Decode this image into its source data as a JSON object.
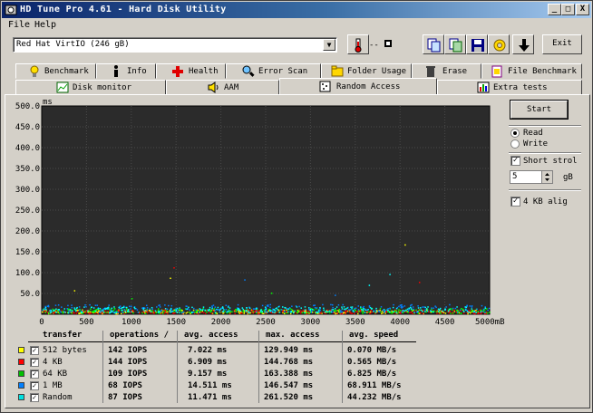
{
  "window": {
    "title": "HD Tune Pro 4.61 - Hard Disk Utility",
    "min_label": "_",
    "max_label": "□",
    "close_label": "X"
  },
  "menu": {
    "file": "File",
    "help": "Help"
  },
  "toolbar": {
    "drive": "Red Hat VirtIO (246 gB)",
    "temperature": "--",
    "exit_label": "Exit",
    "icons": [
      "thermometer-icon",
      "copy-icon",
      "copy-text-icon",
      "save-icon",
      "options-icon",
      "download-icon"
    ]
  },
  "tabs_row1": [
    {
      "label": "Benchmark",
      "icon": "benchmark-icon"
    },
    {
      "label": "Info",
      "icon": "info-icon"
    },
    {
      "label": "Health",
      "icon": "health-icon"
    },
    {
      "label": "Error Scan",
      "icon": "error-scan-icon"
    },
    {
      "label": "Folder Usage",
      "icon": "folder-icon"
    },
    {
      "label": "Erase",
      "icon": "erase-icon"
    },
    {
      "label": "File Benchmark",
      "icon": "file-benchmark-icon"
    }
  ],
  "tabs_row2": [
    {
      "label": "Disk monitor",
      "icon": "disk-monitor-icon"
    },
    {
      "label": "AAM",
      "icon": "speaker-icon"
    },
    {
      "label": "Random Access",
      "icon": "random-access-icon",
      "active": true
    },
    {
      "label": "Extra tests",
      "icon": "extra-tests-icon"
    }
  ],
  "controls": {
    "start_label": "Start",
    "read_label": "Read",
    "write_label": "Write",
    "mode_selected": "Read",
    "short_stroke_label": "Short strol",
    "short_stroke_checked": true,
    "stroke_value": "5",
    "stroke_unit": "gB",
    "align_label": "4 KB alig",
    "align_checked": true
  },
  "chart_data": {
    "type": "scatter",
    "ylabel": "ms",
    "xlabel": "mB",
    "xlim": [
      0,
      5000
    ],
    "ylim": [
      0,
      500
    ],
    "y_ticks": [
      "500.0",
      "450.0",
      "400.0",
      "350.0",
      "300.0",
      "250.0",
      "200.0",
      "150.0",
      "100.0",
      "50.0"
    ],
    "x_ticks": [
      "0",
      "500",
      "1000",
      "1500",
      "2000",
      "2500",
      "3000",
      "3500",
      "4000",
      "4500",
      "5000mB"
    ],
    "series": [
      {
        "name": "512 bytes",
        "color": "#ffff00",
        "typical_ms": 7.0
      },
      {
        "name": "4 KB",
        "color": "#ff0000",
        "typical_ms": 6.9
      },
      {
        "name": "64 KB",
        "color": "#00ff00",
        "typical_ms": 9.2
      },
      {
        "name": "1 MB",
        "color": "#0080ff",
        "typical_ms": 14.5
      },
      {
        "name": "Random",
        "color": "#00ffff",
        "typical_ms": 11.5
      }
    ],
    "outliers": [
      {
        "x": 1430,
        "y": 88
      },
      {
        "x": 1470,
        "y": 113
      },
      {
        "x": 2560,
        "y": 52
      },
      {
        "x": 3270,
        "y": 47
      },
      {
        "x": 3880,
        "y": 97
      },
      {
        "x": 4050,
        "y": 168
      },
      {
        "x": 4210,
        "y": 78
      },
      {
        "x": 1000,
        "y": 39
      },
      {
        "x": 2260,
        "y": 84
      },
      {
        "x": 3650,
        "y": 71
      },
      {
        "x": 360,
        "y": 58
      }
    ]
  },
  "results": {
    "headers": [
      "transfer",
      "operations /",
      "avg. access",
      "max. access",
      "avg. speed"
    ],
    "rows": [
      {
        "name": "512 bytes",
        "color": "#ffff00",
        "ops": "142 IOPS",
        "avg": "7.022 ms",
        "max": "129.949 ms",
        "speed": "0.070 MB/s"
      },
      {
        "name": "4 KB",
        "color": "#ff0000",
        "ops": "144 IOPS",
        "avg": "6.909 ms",
        "max": "144.768 ms",
        "speed": "0.565 MB/s"
      },
      {
        "name": "64 KB",
        "color": "#00c000",
        "ops": "109 IOPS",
        "avg": "9.157 ms",
        "max": "163.388 ms",
        "speed": "6.825 MB/s"
      },
      {
        "name": "1 MB",
        "color": "#0080ff",
        "ops": "68 IOPS",
        "avg": "14.511 ms",
        "max": "146.547 ms",
        "speed": "68.911 MB/s"
      },
      {
        "name": "Random",
        "color": "#00e0e0",
        "ops": "87 IOPS",
        "avg": "11.471 ms",
        "max": "261.520 ms",
        "speed": "44.232 MB/s"
      }
    ]
  }
}
